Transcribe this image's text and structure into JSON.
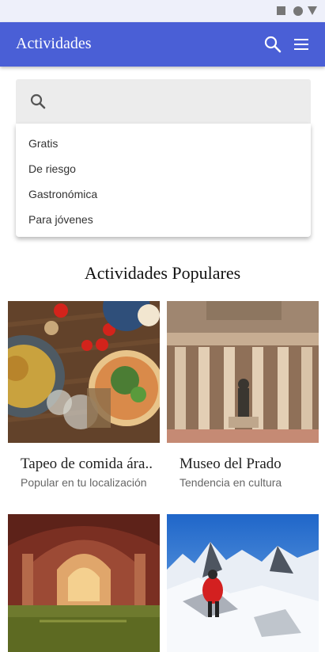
{
  "status_bar": {
    "icons": [
      "square-icon",
      "circle-icon",
      "triangle-icon"
    ]
  },
  "app_bar": {
    "title": "Actividades",
    "actions": [
      "search-icon",
      "menu-icon"
    ]
  },
  "search": {
    "value": "",
    "placeholder": ""
  },
  "dropdown": {
    "items": [
      "Gratis",
      "De riesgo",
      "Gastronómica",
      "Para jóvenes"
    ]
  },
  "section": {
    "title": "Actividades Populares"
  },
  "cards": [
    {
      "title": "Tapeo de comida ára..",
      "subtitle": "Popular en tu localización"
    },
    {
      "title": "Museo del Prado",
      "subtitle": "Tendencia en cultura"
    },
    {
      "title": "",
      "subtitle": ""
    },
    {
      "title": "",
      "subtitle": ""
    }
  ],
  "colors": {
    "app_bar": "#4a5fd6",
    "status_bar": "#eef0fa",
    "search_bg": "#ececec"
  }
}
